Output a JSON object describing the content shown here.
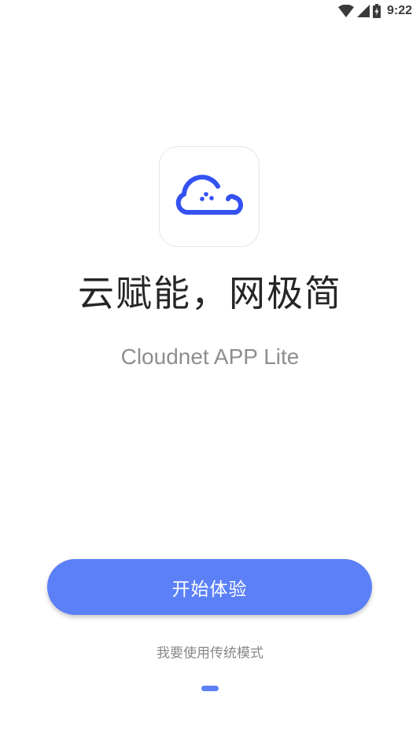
{
  "status_bar": {
    "time": "9:22",
    "icons": [
      "wifi-icon",
      "cellular-signal-icon",
      "battery-charging-icon"
    ]
  },
  "app_icon": {
    "name": "cloud-logo-icon",
    "color": "#3451f2"
  },
  "headline": "云赋能，网极简",
  "subtitle": "Cloudnet APP Lite",
  "start_button": {
    "label": "开始体验",
    "color": "#5b80f7"
  },
  "traditional_mode_link": "我要使用传统模式",
  "page_indicator": {
    "active_index": 0,
    "color": "#5b80f7"
  }
}
